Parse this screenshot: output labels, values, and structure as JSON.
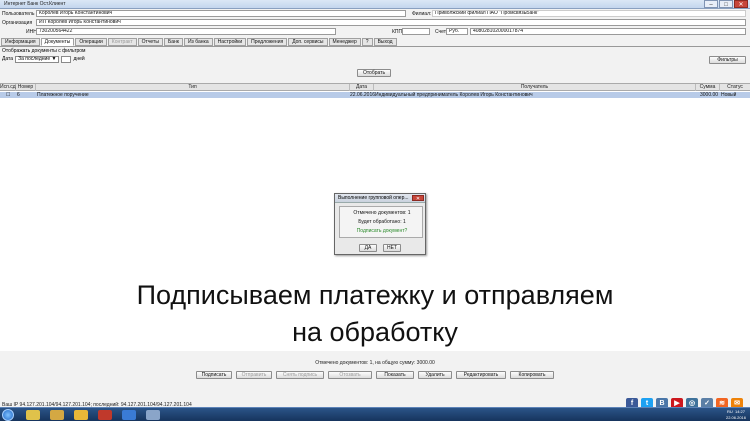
{
  "window": {
    "title": "Интернет Банк Ост.Клиент",
    "minimize": "–",
    "maximize": "□",
    "close": "✕"
  },
  "header": {
    "user_label": "Пользователь",
    "user_value": "Королев Игорь Константинович",
    "branch_label": "Филиал:",
    "branch_value": "Приволжский филиал ПАО \"ПромсвязьБанк\"",
    "org_label": "Организация",
    "org_value": "ИП Королев Игорь Константинович",
    "inn_label": "ИНН",
    "inn_value": "730200564422",
    "kpp_label": "КПП",
    "kpp_value": "",
    "account_label": "Счет",
    "currency_value": "Руб.",
    "account_value": "40802810200001787​4"
  },
  "tabs": [
    {
      "label": "Информация",
      "state": "normal"
    },
    {
      "label": "Документы",
      "state": "active"
    },
    {
      "label": "Операции",
      "state": "normal"
    },
    {
      "label": "Контракт",
      "state": "disabled"
    },
    {
      "label": "Отчеты",
      "state": "normal"
    },
    {
      "label": "Банк",
      "state": "normal"
    },
    {
      "label": "Из банка",
      "state": "normal"
    },
    {
      "label": "Настройки",
      "state": "normal"
    },
    {
      "label": "Предложения",
      "state": "normal"
    },
    {
      "label": "Доп. сервисы",
      "state": "normal"
    },
    {
      "label": "Менеджер",
      "state": "normal"
    },
    {
      "label": "?",
      "state": "normal"
    },
    {
      "label": "Выход",
      "state": "normal"
    }
  ],
  "filters": {
    "caption": "Отображать документы с фильтром",
    "date_label": "Дата",
    "period_value": "За последние",
    "period_arrow": "▼",
    "days_label": "дней",
    "show_button": "Отобрать",
    "filters_button": "Фильтры"
  },
  "table": {
    "columns": [
      "Исп.сд",
      "Номер",
      "Тип",
      "Дата",
      "Получатель",
      "Сумма",
      "Статус"
    ],
    "rows": [
      {
        "check": "☐",
        "number": "6",
        "type": "Платежное поручение",
        "date": "22.06.2016",
        "recipient": "Индивидуальный предприниматель Королев Игорь Константинович",
        "amount": "3000.00",
        "status": "Новый"
      }
    ]
  },
  "dialog": {
    "title": "Выполнение групповой опер...",
    "close": "✕",
    "line1": "Отмечено документов: 1",
    "line2": "Будет обработано: 1",
    "line3": "Подписать документ?",
    "yes": "ДА",
    "no": "НЕТ"
  },
  "overlay": {
    "line1": "Подписываем платежку и отправляем",
    "line2": "на обработку"
  },
  "status_line": "Отмечено документов: 1, на общую сумму: 3000.00",
  "actions": [
    "Подписать",
    "Отправить",
    "Снять подпись",
    "Отозвать",
    "Показать",
    "Удалить",
    "Редактировать",
    "Копировать"
  ],
  "footer_ip": "Ваш IP 94.127.201.104/94.127.201.104; последний: 94.127.201.104/94.127.201.104",
  "social": {
    "facebook": "f",
    "twitter": "t",
    "vk": "B",
    "youtube": "▶",
    "instagram": "◎",
    "vk_square": "✓",
    "rss": "≋",
    "ok": "✉"
  },
  "taskbar": {
    "lang": "RU",
    "time": "14:27",
    "date": "22.06.2016"
  }
}
